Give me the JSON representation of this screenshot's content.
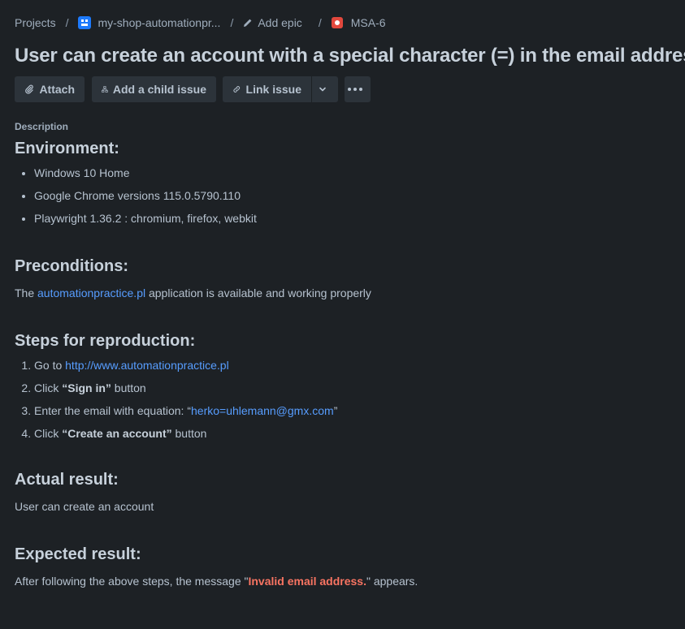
{
  "breadcrumb": {
    "projects": "Projects",
    "separator": "/",
    "project": "my-shop-automationpr...",
    "add_epic": "Add epic",
    "issue_key": "MSA-6"
  },
  "issue": {
    "title": "User can create an account with a special character (=) in the email address"
  },
  "toolbar": {
    "attach": "Attach",
    "add_child": "Add a child issue",
    "link_issue": "Link issue"
  },
  "description": {
    "label": "Description",
    "environment": {
      "heading": "Environment:",
      "items": [
        "Windows 10 Home",
        "Google Chrome versions 115.0.5790.110",
        "Playwright 1.36.2 : chromium, firefox, webkit"
      ]
    },
    "preconditions": {
      "heading": "Preconditions:",
      "prefix": "The ",
      "link": "automationpractice.pl",
      "suffix": " application is available and working properly"
    },
    "steps": {
      "heading": "Steps for reproduction:",
      "step1_prefix": "Go to ",
      "step1_link": "http://www.automationpractice.pl",
      "step2_prefix": "Click ",
      "step2_bold": "“Sign in”",
      "step2_suffix": " button",
      "step3_prefix": "Enter the email with equation: “",
      "step3_link": "herko=uhlemann@gmx.com",
      "step3_suffix": "”",
      "step4_prefix": "Click ",
      "step4_bold": "“Create an account”",
      "step4_suffix": " button"
    },
    "actual": {
      "heading": "Actual result:",
      "text": "User can create an account"
    },
    "expected": {
      "heading": "Expected result:",
      "prefix": "After following the above steps, the message \"",
      "highlight": "Invalid email address.",
      "suffix": "\" appears."
    }
  },
  "colors": {
    "background": "#1d2125",
    "text": "#b6c2cf",
    "link": "#579dff",
    "error": "#f87462",
    "button": "#2c333a",
    "project_icon": "#1d7afc",
    "bug_icon": "#e2483d"
  },
  "icons": [
    "project-icon",
    "pencil-icon",
    "bug-icon",
    "paperclip-icon",
    "hierarchy-icon",
    "link-icon",
    "chevron-down-icon",
    "more-icon"
  ]
}
